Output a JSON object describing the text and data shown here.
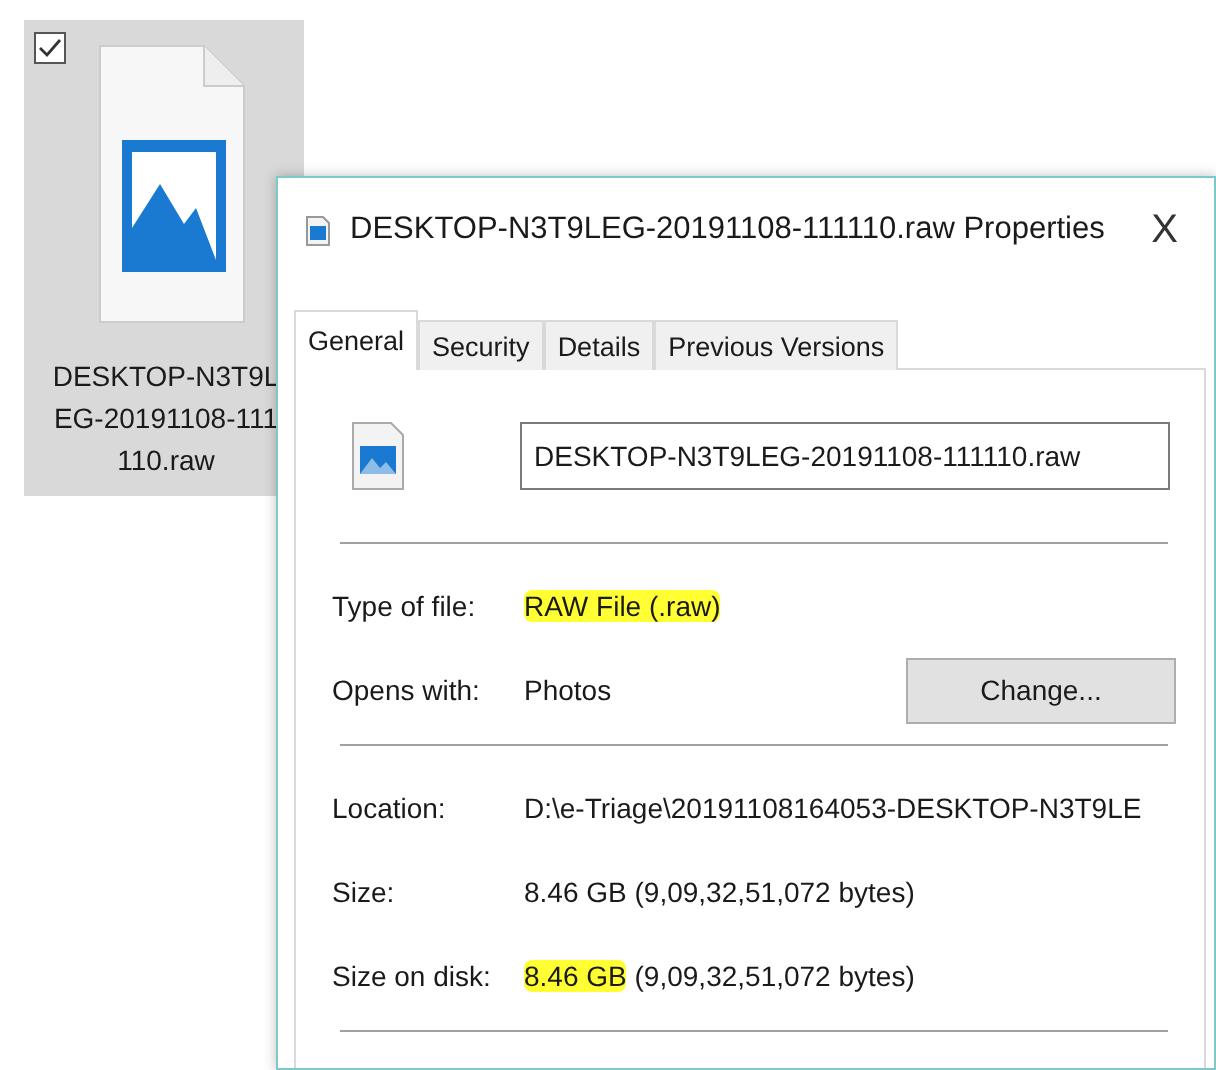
{
  "desktop_item": {
    "checked": true,
    "label_lines": [
      "DESKTOP-N3T9L",
      "EG-20191108-111",
      "110.raw"
    ],
    "selected": true
  },
  "window": {
    "title": "DESKTOP-N3T9LEG-20191108-111110.raw Properties",
    "close": "X"
  },
  "tabs": [
    {
      "label": "General",
      "selected": true
    },
    {
      "label": "Security",
      "selected": false
    },
    {
      "label": "Details",
      "selected": false
    },
    {
      "label": "Previous Versions",
      "selected": false
    }
  ],
  "name_field": {
    "value": "DESKTOP-N3T9LEG-20191108-111110.raw"
  },
  "sections": [
    [
      {
        "label": "Type of file:",
        "parts": [
          {
            "text": "RAW File (.raw)",
            "highlighted": true
          }
        ]
      },
      {
        "label": "Opens with:",
        "parts": [
          {
            "text": "Photos",
            "highlighted": false
          }
        ],
        "button": "Change..."
      }
    ],
    [
      {
        "label": "Location:",
        "parts": [
          {
            "text": "D:\\e-Triage\\20191108164053-DESKTOP-N3T9LE",
            "highlighted": false
          }
        ]
      },
      {
        "label": "Size:",
        "parts": [
          {
            "text": "8.46 GB (9,09,32,51,072 bytes)",
            "highlighted": false
          }
        ]
      },
      {
        "label": "Size on disk:",
        "parts": [
          {
            "text": "8.46 GB",
            "highlighted": true
          },
          {
            "text": " (9,09,32,51,072 bytes)",
            "highlighted": false
          }
        ]
      }
    ]
  ]
}
